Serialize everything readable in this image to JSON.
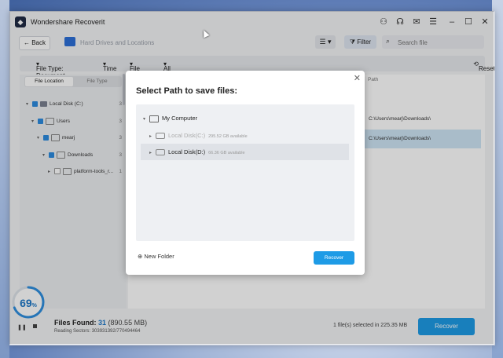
{
  "app": {
    "title": "Wondershare Recoverit",
    "logo": "recoverit-logo"
  },
  "toolbar": {
    "back_label": "Back",
    "breadcrumb": "Hard Drives and Locations",
    "filter_label": "Filter",
    "search_placeholder": "Search file"
  },
  "filters": {
    "file_type": "File Type: Document",
    "time": "Time",
    "file_size": "File Size",
    "all_files": "All files",
    "reset": "Reset"
  },
  "sidebar": {
    "tabs": [
      "File Location",
      "File Type"
    ],
    "tree": [
      {
        "label": "Local Disk (C:)",
        "count": "3"
      },
      {
        "label": "Users",
        "count": "3"
      },
      {
        "label": "mearj",
        "count": "3"
      },
      {
        "label": "Downloads",
        "count": "3"
      },
      {
        "label": "platform-tools_r...",
        "count": "1"
      }
    ]
  },
  "table": {
    "path_header": "Path",
    "rows": [
      "C:\\Users\\mearj\\Downloads\\",
      "C:\\Users\\mearj\\Downloads\\"
    ]
  },
  "dialog": {
    "title": "Select Path to save files:",
    "root": "My Computer",
    "drives": [
      {
        "label": "Local Disk(C:)",
        "available": "295.52 GB available",
        "enabled": false
      },
      {
        "label": "Local Disk(D:)",
        "available": "66.36 GB available",
        "enabled": true
      }
    ],
    "new_folder": "New Folder",
    "recover": "Recover"
  },
  "status": {
    "progress_number": "69",
    "progress_unit": "%",
    "files_found_label": "Files Found:",
    "files_found_count": "31",
    "files_found_size": "(890.55 MB)",
    "sectors": "Reading Sectors: 303931392/770494464",
    "selected": "1 file(s) selected in 225.35 MB",
    "recover": "Recover"
  },
  "colors": {
    "accent": "#1e9be6",
    "selection": "#cfe6f6"
  }
}
